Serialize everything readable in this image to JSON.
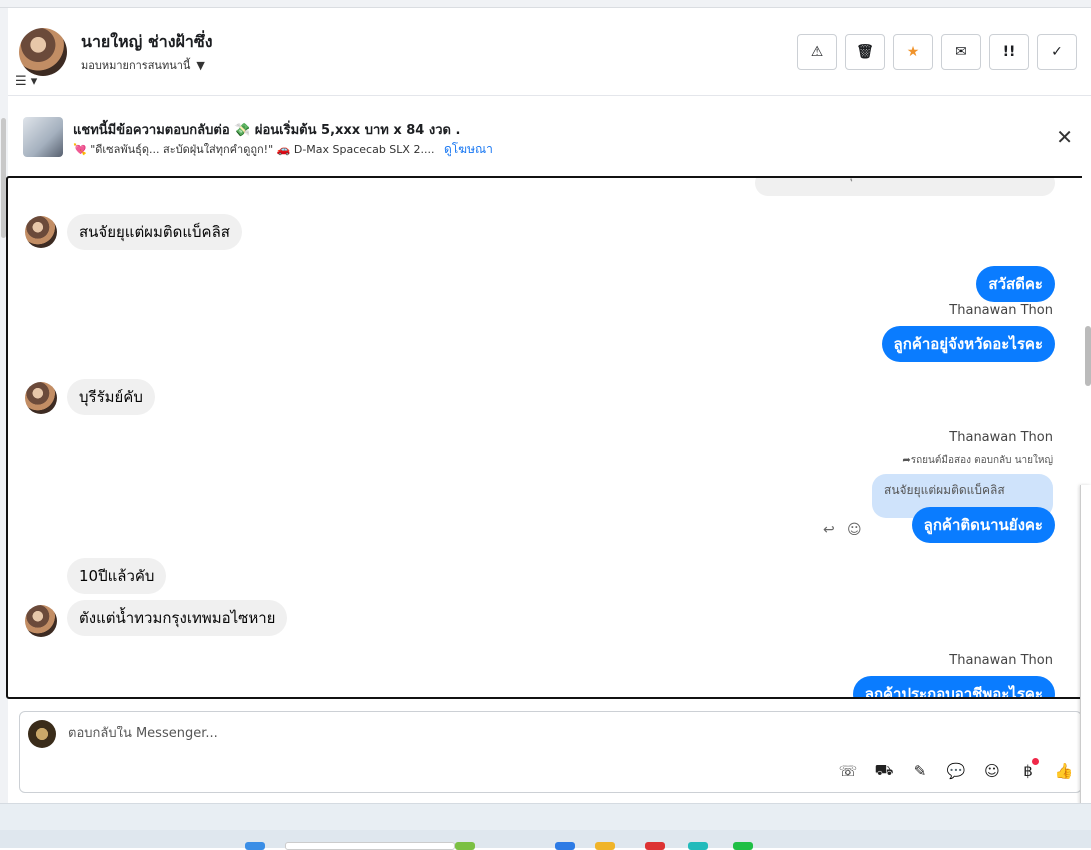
{
  "header": {
    "name": "นายใหญ่ ช่างฝ้าซึ่ง",
    "subtitle": "มอบหมายการสนทนานี้",
    "buttons": [
      "warning",
      "trash",
      "star",
      "mail",
      "mark-important",
      "done"
    ]
  },
  "ad": {
    "title": "แชทนี้มีข้อความตอบกลับต่อ 💸 ผ่อนเริ่มต้น 5,xxx บาท x 84 งวด .",
    "subtitle": "💘 \"ดีเซลพันธุ์ดุ... สะบัดฝุ่นใส่ทุกคำดูถูก!\" 🚗 D-Max Spacecab SLX 2....",
    "link": "ดูโฆษณา"
  },
  "messages": {
    "partial_top": "ลงข้อความกระตุ้นให้เขาตัดสินใจแล้ว",
    "m1": "สนจัยยุแต่ผมติดแบ็คลิส",
    "m2": "สวัสดีคะ",
    "sender1": "Thanawan Thon",
    "m3": "ลูกค้าอยู่จังหวัดอะไรคะ",
    "m4": "บุรีรัมย์คับ",
    "sender2": "Thanawan Thon",
    "reply_info": "รถยนต์มือสอง ตอบกลับ นายใหญ่",
    "quoted": "สนจัยยุแต่ผมติดแบ็คลิส",
    "m5": "ลูกค้าติดนานยังคะ",
    "m6": "10ปีแล้วคับ",
    "m7": "ตังแต่น้ำทวมกรุงเทพมอไซหาย",
    "sender3": "Thanawan Thon",
    "m8": "ลูกค้าประกอบอาชีพอะไรคะ"
  },
  "composer": {
    "placeholder": "ตอบกลับใน Messenger..."
  },
  "colors": {
    "outgoing": "#0a7cff",
    "incoming": "#f0f0f0",
    "quoted": "#cfe3fb"
  }
}
